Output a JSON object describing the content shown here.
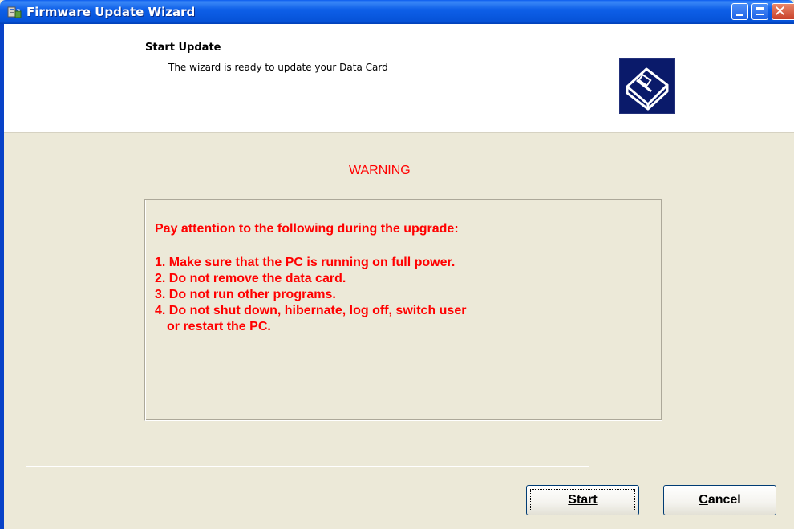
{
  "window": {
    "title": "Firmware Update Wizard",
    "controls": [
      "minimize-icon",
      "maximize-icon",
      "close-icon"
    ]
  },
  "header": {
    "title": "Start Update",
    "subtitle": "The wizard is ready to update your Data Card",
    "icon": "hardware-card-icon"
  },
  "warning": {
    "heading": "WARNING",
    "intro": "Pay attention to the following during the upgrade:",
    "items": [
      "1. Make sure that the PC is running on full power.",
      "2. Do not remove the data card.",
      "3. Do not run other programs.",
      "4. Do not shut down, hibernate, log off, switch user",
      "or restart the PC."
    ],
    "color": "#FF0000"
  },
  "buttons": {
    "start_label": "Start",
    "cancel_label": "Cancel"
  },
  "colors": {
    "titlebar": "#0A5BEE",
    "dialog_bg": "#ECE9D8",
    "header_bg": "#FFFFFF"
  }
}
